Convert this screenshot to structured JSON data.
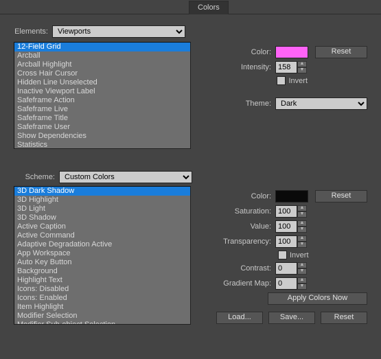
{
  "tab": "Colors",
  "elements_label": "Elements:",
  "elements_combo": "Viewports",
  "elements_list": [
    "12-Field Grid",
    "Arcball",
    "Arcball Highlight",
    "Cross Hair Cursor",
    "Hidden Line Unselected",
    "Inactive Viewport Label",
    "Safeframe Action",
    "Safeframe Live",
    "Safeframe Title",
    "Safeframe User",
    "Show Dependencies",
    "Statistics"
  ],
  "scheme_label": "Scheme:",
  "scheme_combo": "Custom Colors",
  "scheme_list": [
    "3D Dark Shadow",
    "3D Highlight",
    "3D Light",
    "3D Shadow",
    "Active Caption",
    "Active Command",
    "Adaptive Degradation Active",
    "App Workspace",
    "Auto Key Button",
    "Background",
    "Highlight Text",
    "Icons: Disabled",
    "Icons: Enabled",
    "Item Highlight",
    "Modifier Selection",
    "Modifier Sub-object Selection"
  ],
  "right1": {
    "color_label": "Color:",
    "color_value": "#ff63f7",
    "reset": "Reset",
    "intensity_label": "Intensity:",
    "intensity_value": "158",
    "invert_label": "Invert",
    "theme_label": "Theme:",
    "theme_value": "Dark"
  },
  "right2": {
    "color_label": "Color:",
    "color_value": "#0a0a0a",
    "reset": "Reset",
    "saturation_label": "Saturation:",
    "saturation_value": "100",
    "value_label": "Value:",
    "value_value": "100",
    "transparency_label": "Transparency:",
    "transparency_value": "100",
    "invert_label": "Invert",
    "contrast_label": "Contrast:",
    "contrast_value": "0",
    "gradientmap_label": "Gradient Map:",
    "gradientmap_value": "0",
    "apply": "Apply Colors Now"
  },
  "footer": {
    "load": "Load...",
    "save": "Save...",
    "reset": "Reset"
  }
}
